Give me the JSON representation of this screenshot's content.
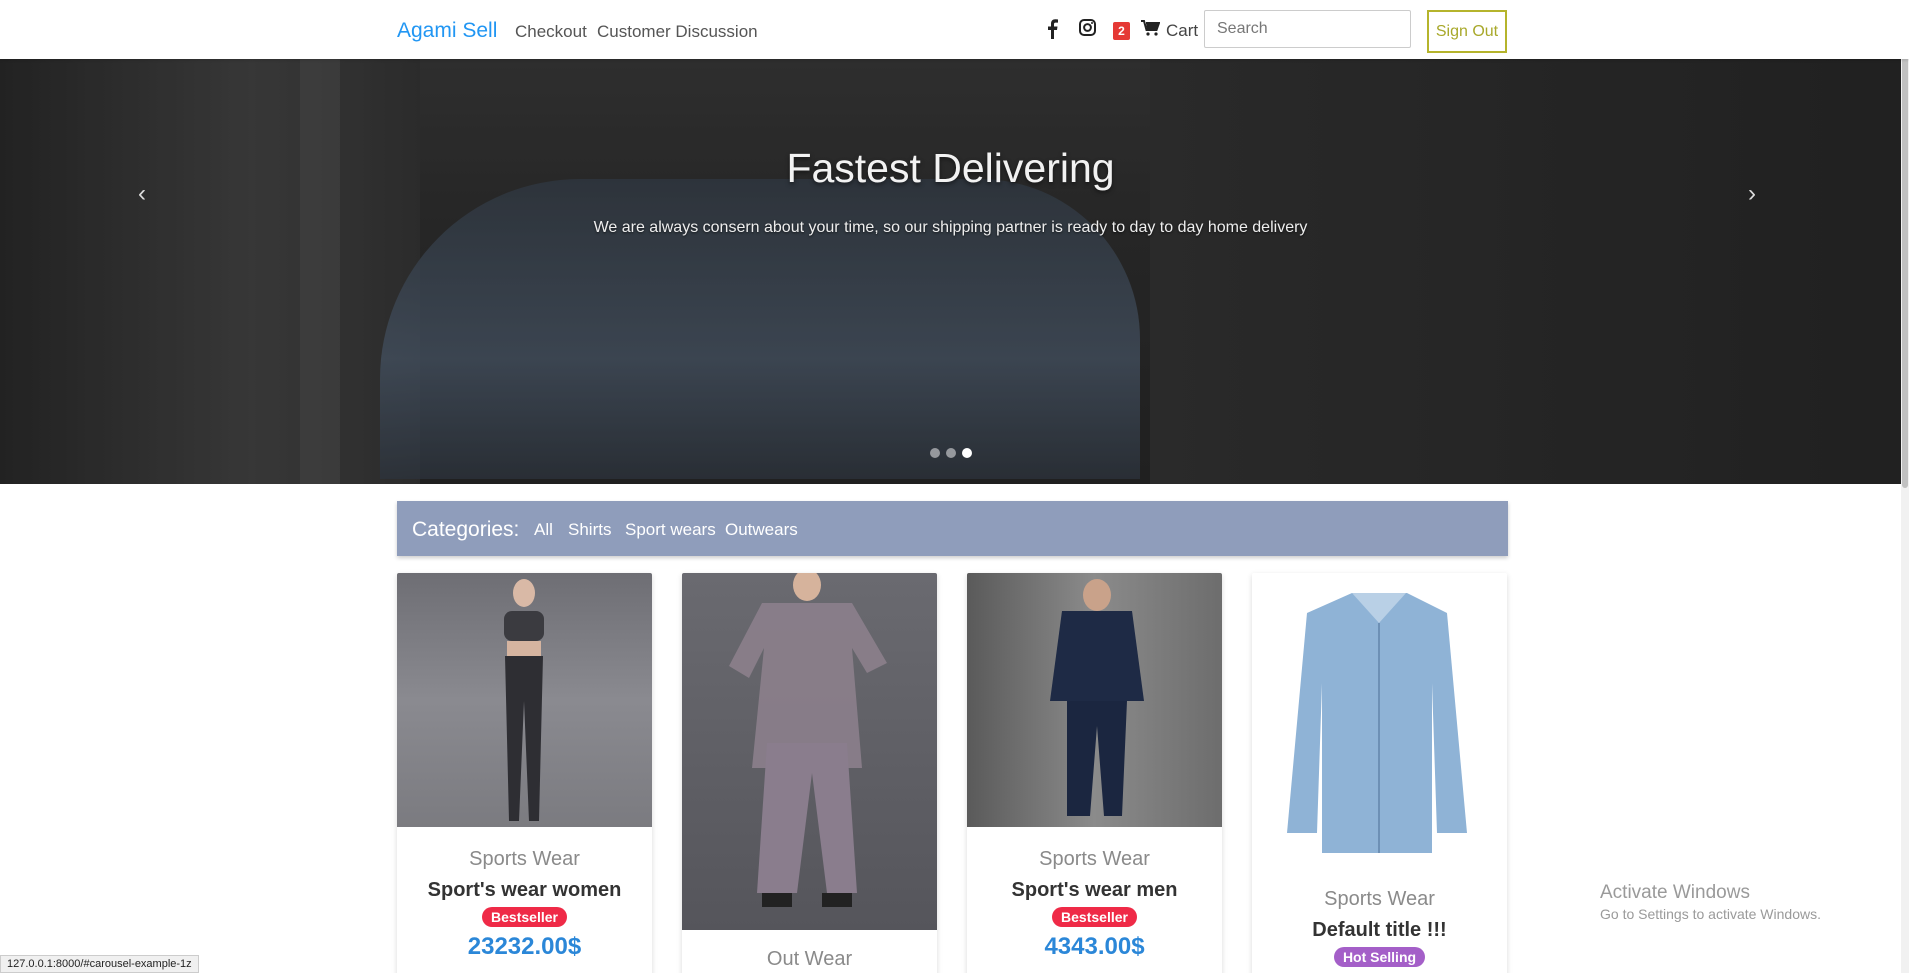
{
  "navbar": {
    "brand": "Agami Sell",
    "links": [
      "Checkout",
      "Customer Discussion"
    ],
    "social_icons": [
      "facebook-icon",
      "instagram-icon"
    ],
    "cart_count": "2",
    "cart_label": "Cart",
    "search_placeholder": "Search",
    "signout_label": "Sign Out",
    "colors": {
      "brand": "#2196f3",
      "signout": "#a8a82a",
      "badge": "#e53935"
    }
  },
  "carousel": {
    "title": "Fastest Delivering",
    "text": "We are always consern about your time, so our shipping partner is ready to day to day home delivery",
    "prev_icon": "‹",
    "next_icon": "›",
    "slides": 3,
    "active_slide": 3
  },
  "categories": {
    "title": "Categories:",
    "items": [
      "All",
      "Shirts",
      "Sport wears",
      "Outwears"
    ],
    "color": "#8f9dbb"
  },
  "products": [
    {
      "category": "Sports Wear",
      "title": "Sport's wear women",
      "badge": "Bestseller",
      "price": "23232.00$"
    },
    {
      "category": "Out Wear",
      "title": "",
      "badge": "",
      "price": ""
    },
    {
      "category": "Sports Wear",
      "title": "Sport's wear men",
      "badge": "Bestseller",
      "price": "4343.00$"
    },
    {
      "category": "Sports Wear",
      "title": "Default title !!!",
      "badge": "Hot Selling",
      "price": ""
    }
  ],
  "status_url": "127.0.0.1:8000/#carousel-example-1z",
  "watermark": {
    "line1": "Activate Windows",
    "line2": "Go to Settings to activate Windows."
  }
}
